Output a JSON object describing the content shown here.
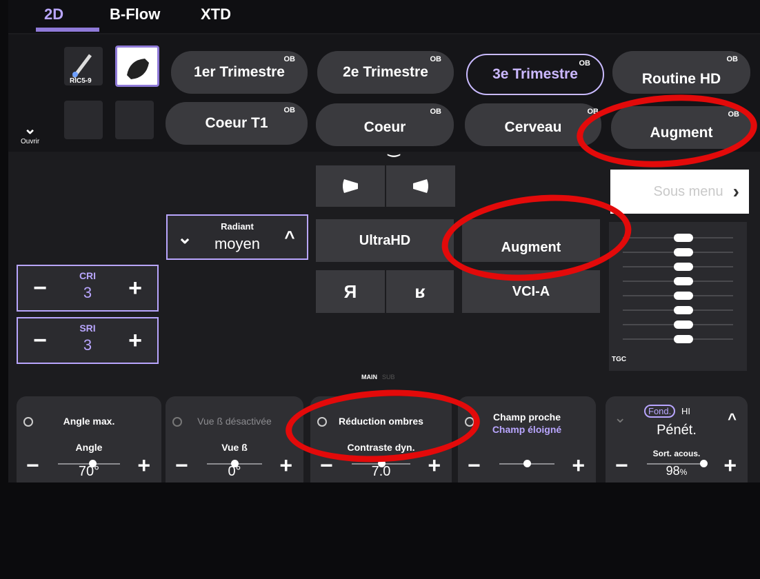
{
  "tabs": [
    "2D",
    "B-Flow",
    "XTD"
  ],
  "probe": {
    "label": "RIC5-9",
    "open_label": "Ouvrir"
  },
  "presets_row1": [
    {
      "label": "1er Trimestre",
      "badge": "OB"
    },
    {
      "label": "2e Trimestre",
      "badge": "OB"
    },
    {
      "label": "3e Trimestre",
      "badge": "OB",
      "selected": true
    },
    {
      "label": "Routine HD",
      "badge": "OB"
    }
  ],
  "presets_row2": [
    {
      "label": "Coeur T1",
      "badge": "OB"
    },
    {
      "label": "Coeur",
      "badge": "OB"
    },
    {
      "label": "Cerveau",
      "badge": "OB"
    },
    {
      "label": "Augment",
      "badge": "OB"
    }
  ],
  "radiant": {
    "label": "Radiant",
    "value": "moyen"
  },
  "cri": {
    "label": "CRI",
    "value": "3"
  },
  "sri": {
    "label": "SRI",
    "value": "3"
  },
  "center": {
    "ultrahd": "UltraHD",
    "augment": "Augment",
    "vcia": "VCI-A"
  },
  "submenu": "Sous menu",
  "tgc": {
    "label": "TGC",
    "levels": [
      0.55,
      0.55,
      0.55,
      0.55,
      0.55,
      0.55,
      0.55,
      0.55
    ]
  },
  "main_sub": {
    "main": "MAIN",
    "sub": "SUB"
  },
  "bottom": [
    {
      "title": "Angle max.",
      "sub": "Angle",
      "value": "70°",
      "level": 0.55
    },
    {
      "title": "Vue ß désactivée",
      "sub": "Vue ß",
      "value": "0°",
      "level": 0.5
    },
    {
      "title": "Réduction ombres",
      "sub": "Contraste dyn.",
      "value": "7.0",
      "level": 0.5
    },
    {
      "title": "Champ proche",
      "title2": "Champ éloigné",
      "level": 0.5
    },
    {
      "mode_a": "Fond.",
      "mode_b": "HI",
      "title": "Pénét.",
      "sub": "Sort. acous.",
      "value": "98",
      "unit": "%",
      "level": 0.95
    }
  ]
}
